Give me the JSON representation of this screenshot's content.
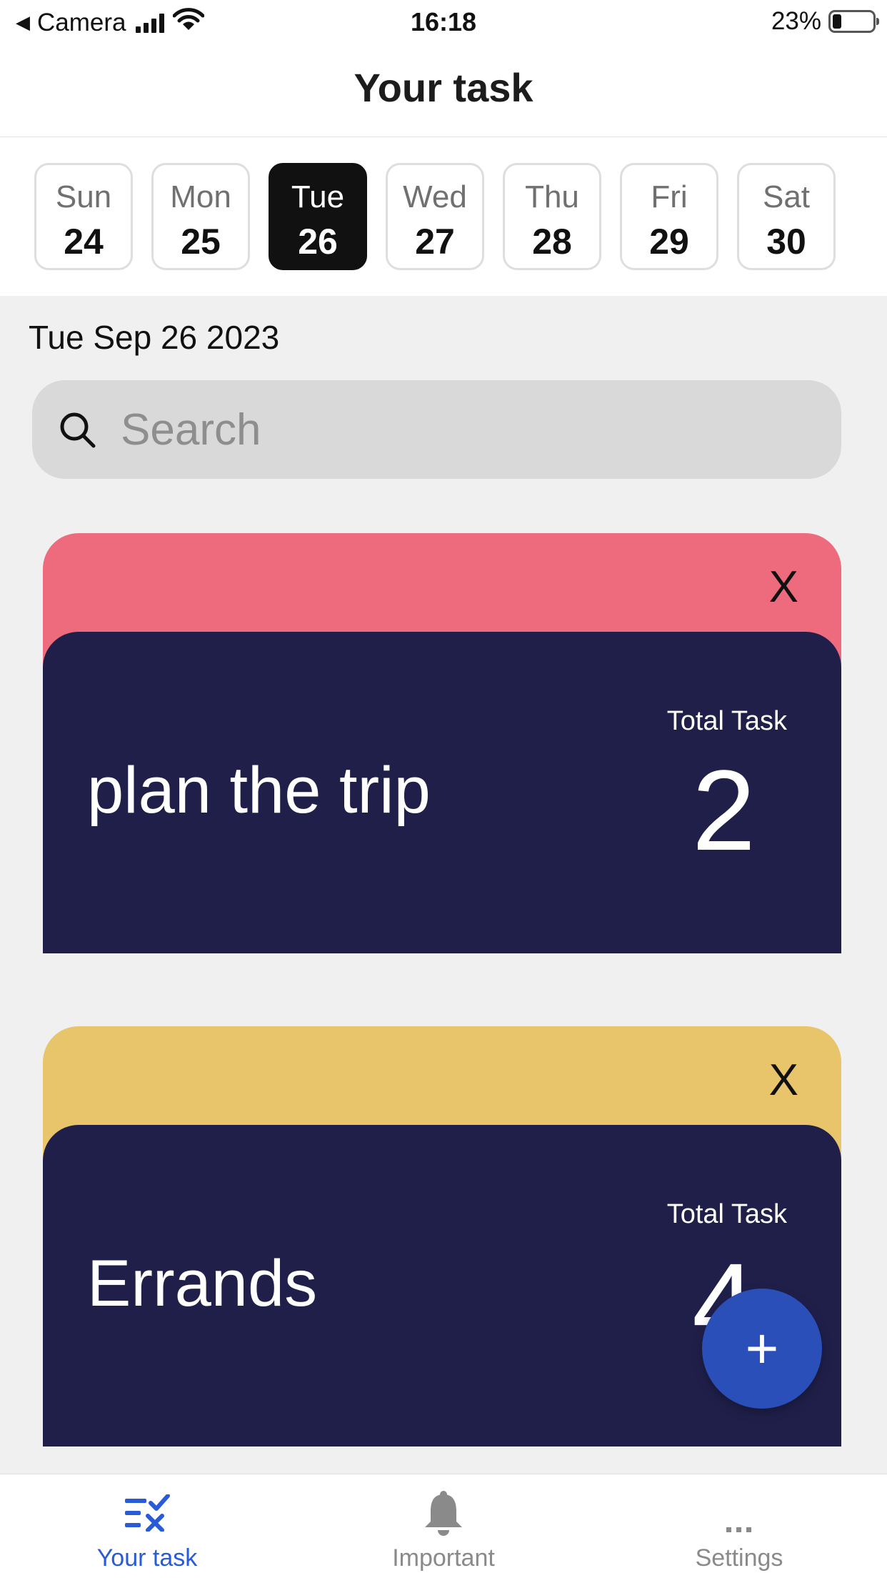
{
  "status_bar": {
    "back_label": "Camera",
    "time": "16:18",
    "battery_text": "23%",
    "battery_level": 0.23
  },
  "header": {
    "title": "Your task"
  },
  "week": [
    {
      "name": "Sun",
      "num": "24"
    },
    {
      "name": "Mon",
      "num": "25"
    },
    {
      "name": "Tue",
      "num": "26"
    },
    {
      "name": "Wed",
      "num": "27"
    },
    {
      "name": "Thu",
      "num": "28"
    },
    {
      "name": "Fri",
      "num": "29"
    },
    {
      "name": "Sat",
      "num": "30"
    }
  ],
  "selected_day_index": 2,
  "date_label": "Tue Sep 26 2023",
  "search": {
    "placeholder": "Search",
    "value": ""
  },
  "cards": [
    {
      "title": "plan the trip",
      "total_label": "Total Task",
      "total": "2",
      "color": "#ee6b7e",
      "close": "X"
    },
    {
      "title": "Errands",
      "total_label": "Total Task",
      "total": "4",
      "color": "#e8c56a",
      "close": "X"
    }
  ],
  "fab": {
    "label": "+"
  },
  "bottom_nav": [
    {
      "label": "Your task",
      "icon": "checklist-icon",
      "active": true
    },
    {
      "label": "Important",
      "icon": "bell-icon",
      "active": false
    },
    {
      "label": "Settings",
      "icon": "more-icon",
      "active": false
    }
  ],
  "colors": {
    "card_body": "#1f1f4a",
    "accent_blue": "#2a5bd7",
    "fab": "#2a4fb8"
  }
}
